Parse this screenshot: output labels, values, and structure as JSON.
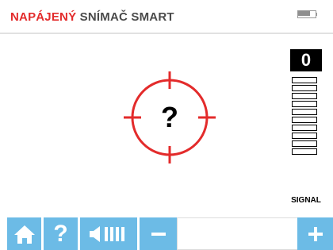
{
  "header": {
    "title_accent": "NAPÁJENÝ",
    "title_rest": "SNÍMAČ SMART",
    "accent_color": "#e32b2b"
  },
  "target": {
    "symbol": "?",
    "icon": "crosshair-target-icon",
    "color": "#e32b2b"
  },
  "signal": {
    "count": "0",
    "label": "SIGNAL",
    "level": 0,
    "bars_total": 10
  },
  "toolbar": {
    "button_color": "#6cbbe6",
    "home_icon": "home-icon",
    "help_label": "?",
    "volume_icon": "volume-icon",
    "minus_icon": "minus-icon",
    "plus_icon": "plus-icon"
  },
  "battery": {
    "icon": "battery-icon"
  }
}
